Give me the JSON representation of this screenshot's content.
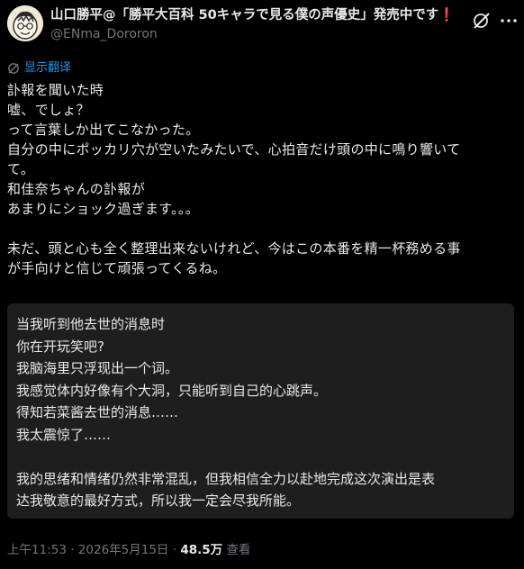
{
  "author": {
    "display_name": "山口勝平@「勝平大百科 50キャラで見る僕の声優史」発売中です",
    "alert_mark": "❗",
    "handle": "@ENma_Dororon",
    "avatar_icon": "avatar-portrait-icon"
  },
  "actions": {
    "grok_icon": "grok-icon",
    "more_icon": "more-options-icon"
  },
  "translate": {
    "label": "显示翻译",
    "icon": "translate-icon"
  },
  "tweet": {
    "lines": [
      "訃報を聞いた時",
      "嘘、でしょ？",
      "って言葉しか出てこなかった。",
      "自分の中にポッカリ穴が空いたみたいで、心拍音だけ頭の中に鳴り響いて",
      "て。",
      "和佳奈ちゃんの訃報が",
      "あまりにショック過ぎます。。。",
      "",
      "未だ、頭と心も全く整理出来ないけれど、今はこの本番を精一杯務める事",
      "が手向けと信じて頑張ってくるね。"
    ]
  },
  "translation": {
    "lines": [
      "当我听到他去世的消息时",
      "你在开玩笑吧?",
      "我脑海里只浮现出一个词。",
      "我感觉体内好像有个大洞，只能听到自己的心跳声。",
      "得知若菜酱去世的消息……",
      "我太震惊了……",
      "",
      "我的思绪和情绪仍然非常混乱，但我相信全力以赴地完成这次演出是表",
      "达我敬意的最好方式，所以我一定会尽我所能。"
    ]
  },
  "meta": {
    "time": "上午11:53",
    "separator": "·",
    "date": "2026年5月15日",
    "view_count": "48.5万",
    "view_label": "查看"
  },
  "colors": {
    "background": "#000000",
    "text": "#e7e9ea",
    "muted": "#71767b",
    "link": "#1d9bf0",
    "box": "#1e1e1e",
    "alert": "#e02b2b"
  }
}
